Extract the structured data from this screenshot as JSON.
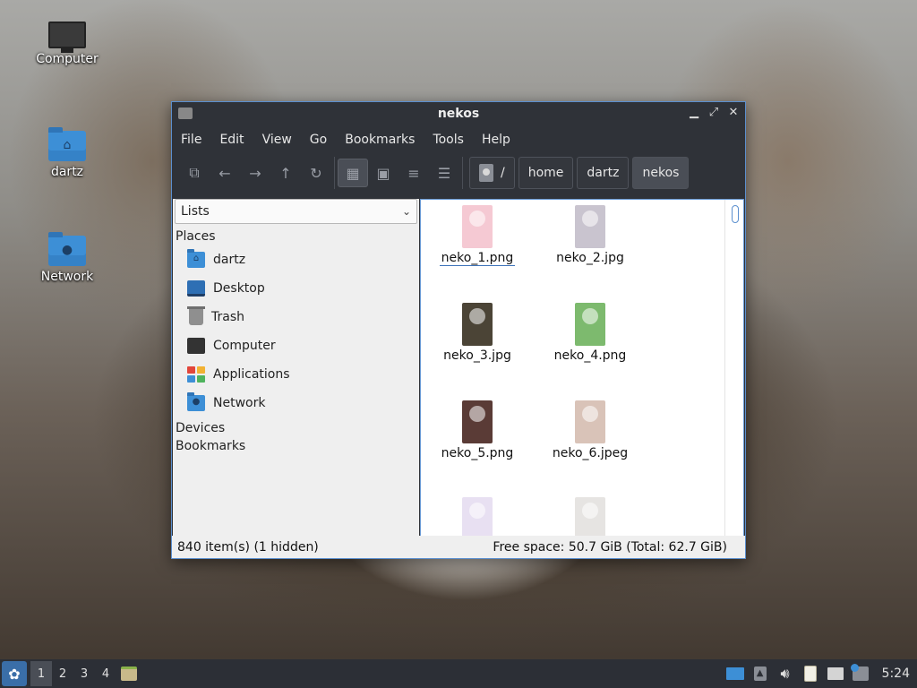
{
  "desktop": {
    "icons": [
      {
        "label": "Computer",
        "icon": "computer-icon"
      },
      {
        "label": "dartz",
        "icon": "home-folder-icon"
      },
      {
        "label": "Network",
        "icon": "network-folder-icon"
      }
    ]
  },
  "window": {
    "title": "nekos",
    "menu": [
      "File",
      "Edit",
      "View",
      "Go",
      "Bookmarks",
      "Tools",
      "Help"
    ],
    "breadcrumb": {
      "root": "/",
      "items": [
        "home",
        "dartz",
        "nekos"
      ]
    },
    "sidepane": {
      "mode": "Lists",
      "places_header": "Places",
      "places": [
        {
          "label": "dartz",
          "icon": "home-folder-icon"
        },
        {
          "label": "Desktop",
          "icon": "desktop-icon"
        },
        {
          "label": "Trash",
          "icon": "trash-icon"
        },
        {
          "label": "Computer",
          "icon": "computer-icon"
        },
        {
          "label": "Applications",
          "icon": "applications-icon"
        },
        {
          "label": "Network",
          "icon": "network-folder-icon"
        }
      ],
      "devices_header": "Devices",
      "bookmarks_header": "Bookmarks"
    },
    "files": [
      {
        "name": "neko_1.png",
        "color": "#f5c9d3"
      },
      {
        "name": "neko_2.jpg",
        "color": "#c9c4cf"
      },
      {
        "name": "neko_3.jpg",
        "color": "#4b4436"
      },
      {
        "name": "neko_4.png",
        "color": "#7dba6e"
      },
      {
        "name": "neko_5.png",
        "color": "#5a3b36"
      },
      {
        "name": "neko_6.jpeg",
        "color": "#d9c3b8"
      },
      {
        "name": "",
        "color": "#e8e0f2"
      },
      {
        "name": "",
        "color": "#e6e4e2"
      }
    ],
    "status": {
      "items": "840 item(s) (1 hidden)",
      "free": "Free space: 50.7 GiB (Total: 62.7 GiB)"
    }
  },
  "taskbar": {
    "workspaces": [
      "1",
      "2",
      "3",
      "4"
    ],
    "clock": "5:24"
  }
}
